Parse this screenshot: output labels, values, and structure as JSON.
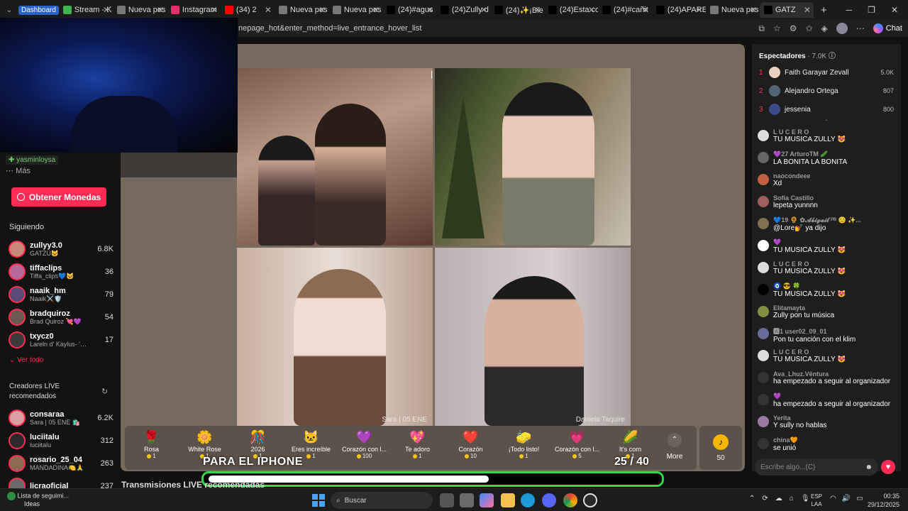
{
  "browser": {
    "tabs": [
      {
        "label": "Dashboard",
        "badge": true,
        "color": "#2a62c9"
      },
      {
        "label": "Stream - K",
        "color": "#3fb34f"
      },
      {
        "label": "Nueva pes",
        "color": "#777777"
      },
      {
        "label": "Instagram",
        "color": "#e1306c"
      },
      {
        "label": "(34) 2",
        "color": "#ff0000"
      },
      {
        "label": "Nueva pes",
        "color": "#777777"
      },
      {
        "label": "Nueva pes",
        "color": "#777777"
      },
      {
        "label": "(24)#agus",
        "color": "#000000"
      },
      {
        "label": "(24)Zully d",
        "color": "#000000"
      },
      {
        "label": "(24)✨¡Bie",
        "color": "#000000"
      },
      {
        "label": "(24)Esta co",
        "color": "#000000"
      },
      {
        "label": "(24)#cañit",
        "color": "#000000"
      },
      {
        "label": "(24)APARE",
        "color": "#000000"
      },
      {
        "label": "Nueva pes",
        "color": "#777777"
      },
      {
        "label": "GATZ",
        "color": "#000000",
        "active": true
      }
    ],
    "url": "nepage_hot&enter_method=live_entrance_hover_list",
    "chat_label": "Chat"
  },
  "leftnav": {
    "top_user": "yasminloysa",
    "more_label": "Más",
    "coins_label": "Obtener Monedas",
    "following_title": "Siguiendo",
    "following": [
      {
        "name": "zullyy3.0",
        "sub": "GATZU🐱",
        "count": "6.8K",
        "color": "#c98a7a"
      },
      {
        "name": "tiffaclips",
        "sub": "Tiffa_clips💙🐱",
        "count": "36",
        "color": "#b66a9a"
      },
      {
        "name": "naaik_hm",
        "sub": "Naaik⚔️🛡️",
        "count": "79",
        "color": "#5a4a7a"
      },
      {
        "name": "bradquiroz",
        "sub": "Brad Quiroz 💘💜",
        "count": "54",
        "color": "#6a5a50"
      },
      {
        "name": "txycz0",
        "sub": "Lareln d' Kaylus- '\\...",
        "count": "17",
        "color": "#3a3a3a"
      }
    ],
    "see_all": "Ver todo",
    "recommended_title": "Creadores LIVE recomendados",
    "recommended": [
      {
        "name": "consaraa",
        "sub": "Sara | 05 ENE 🛍️",
        "count": "6.2K",
        "color": "#d8a0a0"
      },
      {
        "name": "luciitalu",
        "sub": "luciitalu",
        "count": "312",
        "color": "#2a2a2a"
      },
      {
        "name": "rosario_25_04",
        "sub": "MANDADINA🍋🙏",
        "count": "263",
        "color": "#8a6a50"
      },
      {
        "name": "licraoficial",
        "sub": "",
        "count": "237",
        "color": "#6a6a6a"
      }
    ]
  },
  "main": {
    "video_labels": [
      "Sara | 05 ENE",
      "Daniela Taquire"
    ],
    "recommended_section": "Transmisiones LIVE recomendadas"
  },
  "gifts": [
    {
      "icon": "🌹",
      "name": "Rosa",
      "price": "1"
    },
    {
      "icon": "🌼",
      "name": "White Rose",
      "price": "1"
    },
    {
      "icon": "🎊",
      "name": "2026",
      "price": "1"
    },
    {
      "icon": "🐱",
      "name": "Eres increíble",
      "price": "1"
    },
    {
      "icon": "💜",
      "name": "Corazón con l...",
      "price": "100"
    },
    {
      "icon": "💖",
      "name": "Te adoro",
      "price": "1"
    },
    {
      "icon": "❤️",
      "name": "Corazón",
      "price": "10"
    },
    {
      "icon": "🧽",
      "name": "¡Todo listo!",
      "price": "1"
    },
    {
      "icon": "💗",
      "name": "Corazón con l...",
      "price": "5"
    },
    {
      "icon": "🌽",
      "name": "It's corn",
      "price": "1"
    }
  ],
  "gift_more": "More",
  "coin_balance": "50",
  "caption": {
    "text": "PARA EL IPHONE",
    "counter": "25 / 40",
    "progress": 0.625
  },
  "viewers": {
    "title": "Espectadores",
    "count": "7.0K",
    "top": [
      {
        "rank": "1",
        "name": "Faith Garayar Zevall",
        "points": "5.0K",
        "color": "#e8d0c0"
      },
      {
        "rank": "2",
        "name": "Alejandro Ortega",
        "points": "807",
        "color": "#556677"
      },
      {
        "rank": "3",
        "name": "jessenia",
        "points": "800",
        "color": "#3a4a8a"
      }
    ]
  },
  "comments": [
    {
      "user": "L U C E R O",
      "text": "TU MÚSICA ZULLY 😻",
      "color": "#dddddd"
    },
    {
      "user": "💜27  ArturoTM 🥒",
      "text": "LA BONITA LA BONITA",
      "color": "#666666"
    },
    {
      "user": "naocondeee",
      "text": "Xd",
      "color": "#c06040"
    },
    {
      "user": "Sofia Castillo",
      "text": "lepeta yunnnn",
      "color": "#a06060"
    },
    {
      "user": "💙19 🌻 ✿𝓐𝓫𝓲𝓰𝓪𝓲𝓵 ᴾᴮ 😊 ✨...",
      "text": "@Lore💅 ya dijo",
      "color": "#807050"
    },
    {
      "user": "💜",
      "text": "TU MÚSICA ZULLY 😻",
      "color": "#ffffff"
    },
    {
      "user": "L U C E R O",
      "text": "TU MÚSICA ZULLY 😻",
      "color": "#dddddd"
    },
    {
      "user": "🧿 😎 🍀",
      "text": "TU MÚSICA ZULLY 😻",
      "color": "#000000"
    },
    {
      "user": "Elitamayta",
      "text": "Zully pon tu música",
      "color": "#809040"
    },
    {
      "user": "🅰1  user02_09_01",
      "text": "Pon tu canción con el klim",
      "color": "#6a6a9a"
    },
    {
      "user": "L U C E R O",
      "text": "TU MÚSICA ZULLY 😻",
      "color": "#dddddd"
    },
    {
      "user": "Ava_Lhuz.Vêntura",
      "text": "ha empezado a seguir al organizador",
      "color": "#333333"
    },
    {
      "user": "💜",
      "text": "ha empezado a seguir al organizador",
      "color": "#333333"
    },
    {
      "user": "Yerita",
      "text": "Y sully no hablas",
      "color": "#9a7aa0"
    },
    {
      "user": "china🧡",
      "text": "se unió",
      "color": "#333333"
    }
  ],
  "chat_placeholder": "Escribe algo...(C)",
  "taskbar": {
    "search": "Buscar",
    "notice_title": "Lista de seguimi...",
    "notice_sub": "Ideas",
    "lang_top": "ESP",
    "lang_bottom": "LAA",
    "time": "00:35",
    "date": "29/12/2025"
  }
}
